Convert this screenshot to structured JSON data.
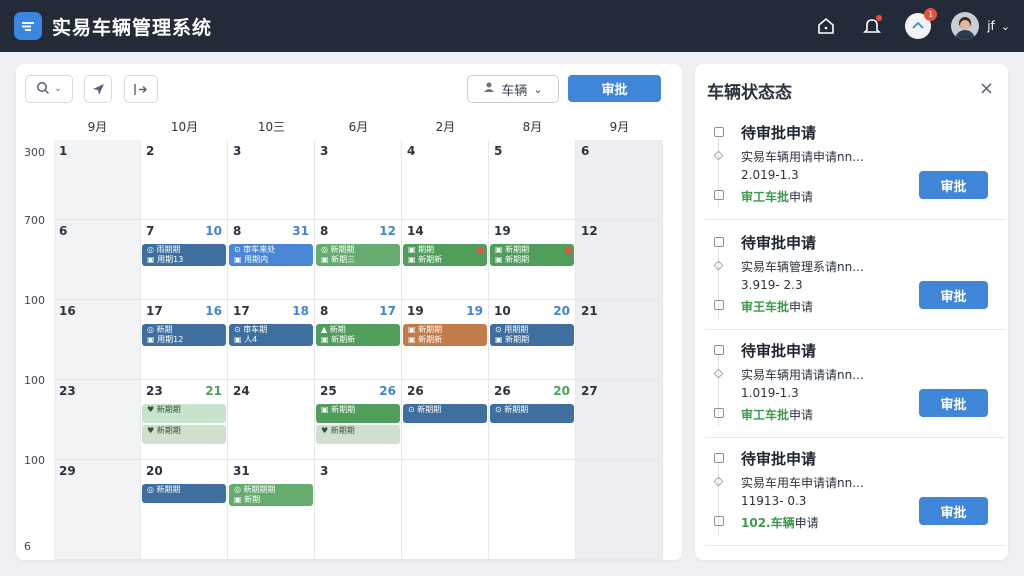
{
  "app": {
    "title": "实易车辆管理系统",
    "username": "jf",
    "notification_count": "1"
  },
  "toolbar": {
    "vehicle_select": "车辆",
    "approve_label": "审批"
  },
  "calendar": {
    "columns": [
      "9月",
      "10月",
      "10三",
      "6月",
      "2月",
      "8月",
      "9月"
    ],
    "row_labels": [
      "300",
      "700",
      "100",
      "100",
      "100",
      "6"
    ],
    "rows": [
      [
        {
          "d": "1"
        },
        {
          "d": "2"
        },
        {
          "d": "3"
        },
        {
          "d": "3"
        },
        {
          "d": "4"
        },
        {
          "d": "5"
        },
        {
          "d": "6"
        }
      ],
      [
        {
          "d": "6"
        },
        {
          "d": "7",
          "d2": "10",
          "events": [
            {
              "c": "blue",
              "l1": "◎ 雨期期",
              "l2": "▣ 用期13"
            }
          ]
        },
        {
          "d": "8",
          "d2": "31",
          "events": [
            {
              "c": "bright",
              "l1": "⊙ 审车来处",
              "l2": "▣ 用期内"
            }
          ]
        },
        {
          "d": "8",
          "d2": "12",
          "events": [
            {
              "c": "greenl",
              "l1": "◎ 新期期",
              "l2": "▣ 新期三"
            }
          ]
        },
        {
          "d": "14",
          "events": [
            {
              "c": "green",
              "l1": "▣ 期期",
              "l2": "▣ 新期新",
              "flag": true
            }
          ]
        },
        {
          "d": "19",
          "events": [
            {
              "c": "green",
              "l1": "▣ 新期期",
              "l2": "▣ 新期期",
              "flag": true
            }
          ]
        },
        {
          "d": "12"
        }
      ],
      [
        {
          "d": "16"
        },
        {
          "d": "17",
          "d2": "16",
          "events": [
            {
              "c": "blue",
              "l1": "◎ 新期",
              "l2": "▣ 用期12"
            }
          ]
        },
        {
          "d": "17",
          "d2": "18",
          "events": [
            {
              "c": "blue",
              "l1": "⊙ 审车期",
              "l2": "▣ 人4"
            }
          ]
        },
        {
          "d": "8",
          "d2": "17",
          "events": [
            {
              "c": "green",
              "l1": "▲ 新期",
              "l2": "▣ 新期新"
            }
          ]
        },
        {
          "d": "19",
          "d2": "19",
          "events": [
            {
              "c": "orange",
              "l1": "▣ 新期期",
              "l2": "▣ 新期新"
            }
          ]
        },
        {
          "d": "10",
          "d2": "20",
          "events": [
            {
              "c": "blue",
              "l1": "⊙ 用期期",
              "l2": "▣ 新期期"
            }
          ]
        },
        {
          "d": "21"
        }
      ],
      [
        {
          "d": "23"
        },
        {
          "d": "23",
          "d2": "21",
          "d2g": true,
          "events": [
            {
              "c": "pale",
              "l1": "♥ 新期期",
              "l2": ""
            },
            {
              "c": "paleg",
              "l1": "♥ 新期期",
              "l2": ""
            }
          ]
        },
        {
          "d": "24"
        },
        {
          "d": "25",
          "d2": "26",
          "events": [
            {
              "c": "green",
              "l1": "▣ 新期期",
              "l2": ""
            },
            {
              "c": "paleg",
              "l1": "♥ 新期期",
              "l2": ""
            }
          ]
        },
        {
          "d": "26",
          "events": [
            {
              "c": "blue",
              "l1": "⊙ 新期期",
              "l2": ""
            }
          ]
        },
        {
          "d": "26",
          "d2": "20",
          "d2g": true,
          "events": [
            {
              "c": "blue",
              "l1": "⊙ 新期期",
              "l2": ""
            }
          ]
        },
        {
          "d": "27"
        }
      ],
      [
        {
          "d": "29"
        },
        {
          "d": "20",
          "events": [
            {
              "c": "blue",
              "l1": "◎ 新期期",
              "l2": ""
            }
          ]
        },
        {
          "d": "31",
          "events": [
            {
              "c": "greenl",
              "l1": "◎ 新期期期",
              "l2": "▣ 新期"
            }
          ]
        },
        {
          "d": "3"
        },
        {
          "d": ""
        },
        {
          "d": ""
        },
        {
          "d": ""
        }
      ]
    ]
  },
  "side": {
    "title": "车辆状态态",
    "close": "×",
    "cards": [
      {
        "title": "待审批申请",
        "desc": "实易车辆用请申请nn...",
        "date": "2.019-1.3",
        "status_green": "审工车批",
        "status_tail": "申请",
        "button": "审批"
      },
      {
        "title": "待审批申请",
        "desc": "实易车辆管理系请nn...",
        "date": "3.919- 2.3",
        "status_green": "审王车批",
        "status_tail": "申请",
        "button": "审批"
      },
      {
        "title": "待审批申请",
        "desc": "实易车辆用请请请nn...",
        "date": "1.019-1.3",
        "status_green": "审工车批",
        "status_tail": "申请",
        "button": "审批"
      },
      {
        "title": "待审批申请",
        "desc": "实易车用车申请请nn...",
        "date": "11913- 0.3",
        "status_green": "102.车辆",
        "status_tail": "申请",
        "button": "审批"
      }
    ]
  },
  "colors": {
    "accent": "#3f85d8",
    "topbar": "#232b38",
    "green": "#4f9e5c",
    "orange": "#c47b4a"
  },
  "icons": [
    "app-logo-icon",
    "home-icon",
    "bell-icon",
    "app-bubble-icon",
    "search-icon",
    "navigate-icon",
    "export-icon",
    "car-icon",
    "close-icon"
  ]
}
